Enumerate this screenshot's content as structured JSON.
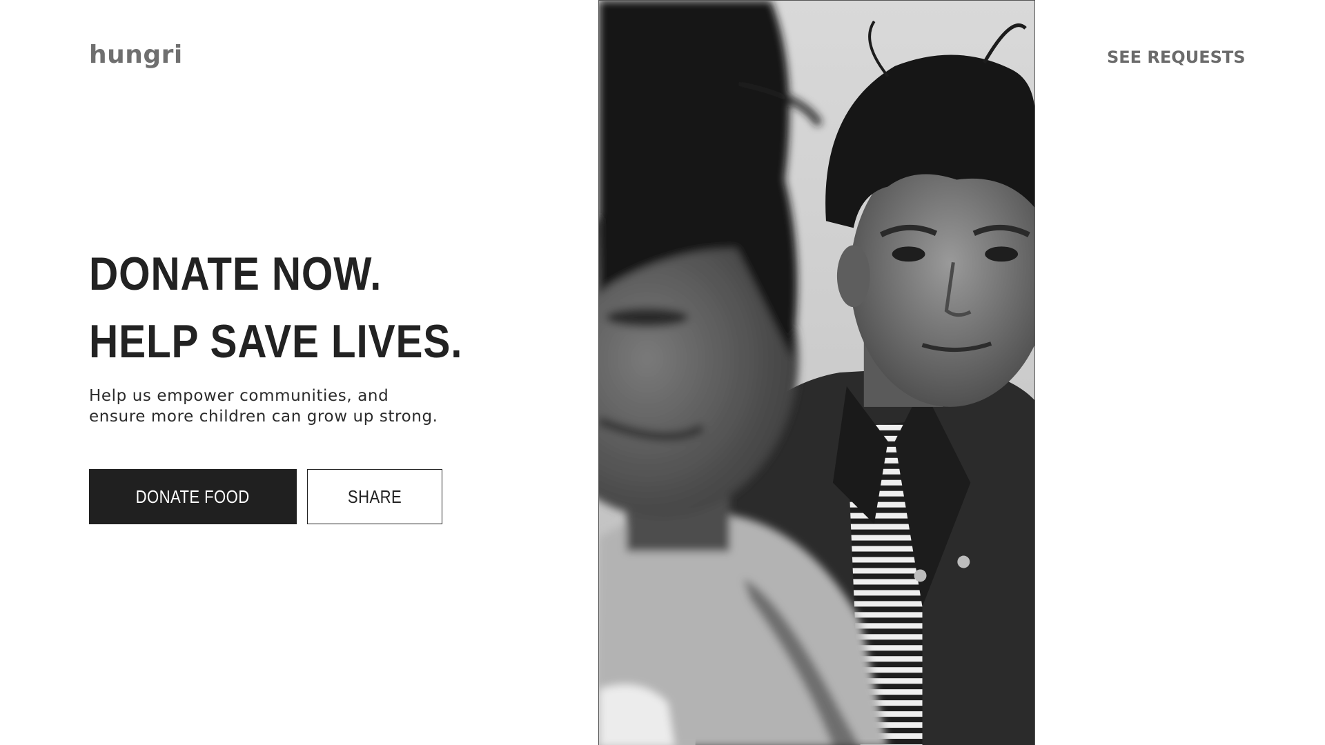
{
  "brand": {
    "logo_text": "hungri"
  },
  "nav": {
    "see_requests_label": "SEE REQUESTS"
  },
  "hero": {
    "headline_line1": "DONATE NOW.",
    "headline_line2": "HELP SAVE LIVES.",
    "subtext": "Help us empower communities, and ensure more children can grow up strong.",
    "primary_button_label": "DONATE FOOD",
    "secondary_button_label": "SHARE"
  },
  "photo": {
    "subject": "black-and-white photograph of two children",
    "tone": "grayscale"
  },
  "colors": {
    "background": "#ffffff",
    "text_dark": "#222222",
    "text_muted": "#6f6f6f",
    "button_dark": "#202020",
    "button_text_light": "#ffffff"
  }
}
